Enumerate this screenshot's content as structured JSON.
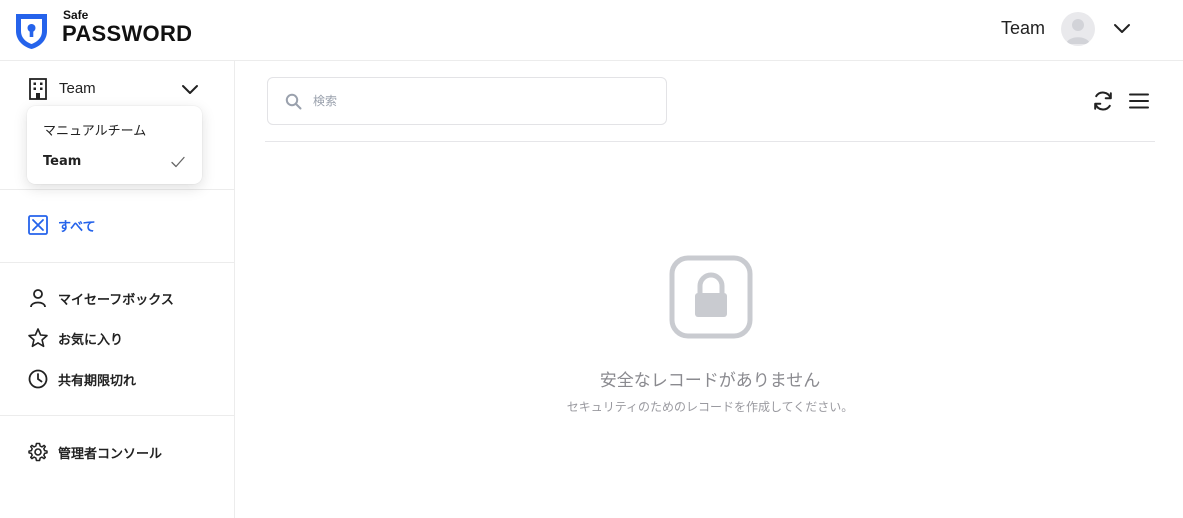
{
  "app": {
    "logo_small": "Safe",
    "logo_big": "PASSWORD"
  },
  "header": {
    "user_name": "Team"
  },
  "sidebar": {
    "team_selector_label": "Team",
    "dropdown": [
      {
        "label": "マニュアルチーム",
        "selected": false
      },
      {
        "label": "Team",
        "selected": true
      }
    ],
    "nav": {
      "all": "すべて",
      "my_safebox": "マイセーフボックス",
      "favorites": "お気に入り",
      "shared_expired": "共有期限切れ",
      "admin_console": "管理者コンソール"
    }
  },
  "main": {
    "search_placeholder": "検索",
    "search_value": "",
    "empty_title": "安全なレコードがありません",
    "empty_subtitle": "セキュリティのためのレコードを作成してください。"
  },
  "colors": {
    "brand": "#2563eb",
    "active_nav": "#2563eb",
    "empty_icon": "#c9cbd0"
  },
  "icons": [
    "shield-keyhole-icon",
    "chevron-down-icon",
    "building-icon",
    "check-icon",
    "all-items-icon",
    "user-icon",
    "star-icon",
    "clock-icon",
    "gear-icon",
    "search-icon",
    "refresh-icon",
    "menu-icon",
    "lock-icon"
  ]
}
